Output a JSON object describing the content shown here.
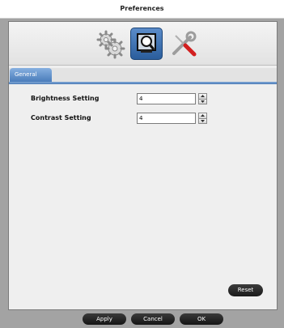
{
  "window": {
    "title": "Preferences"
  },
  "toolbar": {
    "icons": [
      {
        "name": "gears-icon"
      },
      {
        "name": "monitor-magnifier-icon",
        "selected": true
      },
      {
        "name": "wrench-screwdriver-icon"
      }
    ]
  },
  "tabs": [
    {
      "label": "General"
    }
  ],
  "settings": [
    {
      "label": "Brightness Setting",
      "value": "4"
    },
    {
      "label": "Contrast Setting",
      "value": "4"
    }
  ],
  "buttons": {
    "reset": "Reset",
    "apply": "Apply",
    "cancel": "Cancel",
    "ok": "OK"
  },
  "colors": {
    "selected_tab": "#4a7cba",
    "button_dark": "#1a1a1a"
  }
}
